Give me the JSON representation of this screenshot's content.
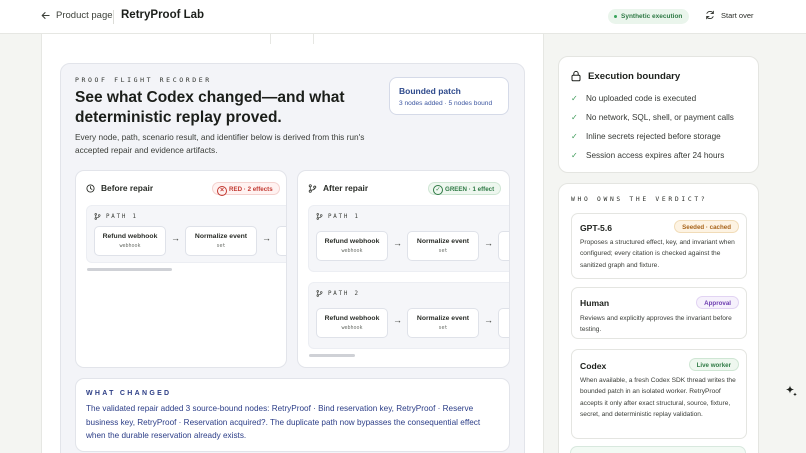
{
  "header": {
    "back_label": "Product page",
    "brand": "RetryProof Lab",
    "synthetic_badge": "Synthetic execution",
    "start_over_label": "Start over"
  },
  "recorder": {
    "eyebrow": "PROOF FLIGHT RECORDER",
    "headline": "See what Codex changed—and what deterministic replay proved.",
    "lead": "Every node, path, scenario result, and identifier below is derived from this run's accepted repair and evidence artifacts.",
    "patch": {
      "title": "Bounded patch",
      "summary": "3 nodes added · 5 nodes bound"
    },
    "before": {
      "title": "Before repair",
      "badge": "RED · 2 effects",
      "paths": [
        {
          "label": "PATH 1",
          "nodes": [
            {
              "title": "Refund webhook",
              "sub": "webhook"
            },
            {
              "title": "Normalize event",
              "sub": "set"
            }
          ]
        }
      ]
    },
    "after": {
      "title": "After repair",
      "badge": "GREEN · 1 effect",
      "paths": [
        {
          "label": "PATH 1",
          "nodes": [
            {
              "title": "Refund webhook",
              "sub": "webhook"
            },
            {
              "title": "Normalize event",
              "sub": "set"
            }
          ]
        },
        {
          "label": "PATH 2",
          "nodes": [
            {
              "title": "Refund webhook",
              "sub": "webhook"
            },
            {
              "title": "Normalize event",
              "sub": "set"
            }
          ]
        }
      ]
    },
    "what_changed": {
      "eyebrow": "WHAT CHANGED",
      "body": "The validated repair added 3 source-bound nodes: RetryProof · Bind reservation key, RetryProof · Reserve business key, RetryProof · Reservation acquired?. The duplicate path now bypasses the consequential effect when the durable reservation already exists."
    }
  },
  "boundary": {
    "title": "Execution boundary",
    "rules": [
      "No uploaded code is executed",
      "No network, SQL, shell, or payment calls",
      "Inline secrets rejected before storage",
      "Session access expires after 24 hours"
    ]
  },
  "verdict": {
    "eyebrow": "WHO OWNS THE VERDICT?",
    "actors": [
      {
        "name": "GPT-5.6",
        "tag": "Seeded · cached",
        "desc": "Proposes a structured effect, key, and invariant when configured; every citation is checked against the sanitized graph and fixture."
      },
      {
        "name": "Human",
        "tag": "Approval",
        "desc": "Reviews and explicitly approves the invariant before testing."
      },
      {
        "name": "Codex",
        "tag": "Live worker",
        "desc": "When available, a fresh Codex SDK thread writes the bounded patch in an isolated worker. RetryProof accepts it only after exact structural, source, fixture, secret, and deterministic replay validation."
      }
    ]
  }
}
